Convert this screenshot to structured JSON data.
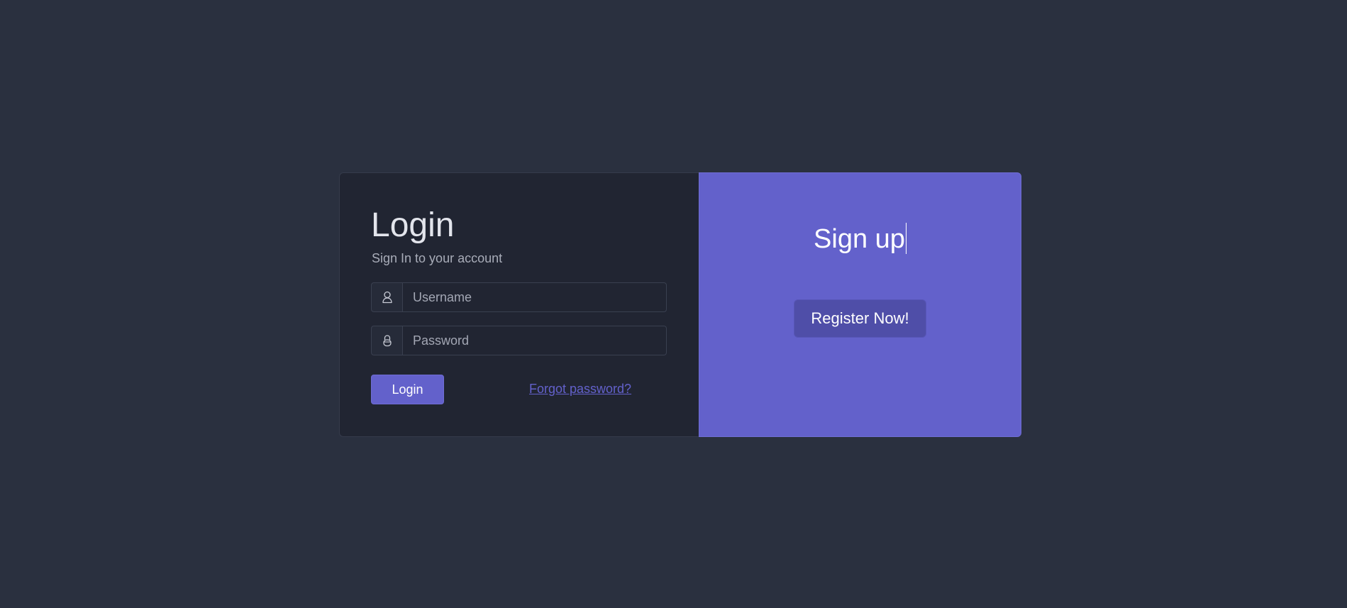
{
  "colors": {
    "background": "#2a303f",
    "login_card": "#212532",
    "accent": "#6361cb",
    "register_button": "#4f4ea8"
  },
  "login": {
    "title": "Login",
    "subtitle": "Sign In to your account",
    "username": {
      "icon": "user-icon",
      "placeholder": "Username",
      "value": ""
    },
    "password": {
      "icon": "lock-icon",
      "placeholder": "Password",
      "value": ""
    },
    "submit_label": "Login",
    "forgot_label": "Forgot password?"
  },
  "signup": {
    "title": "Sign up",
    "register_label": "Register Now!"
  }
}
